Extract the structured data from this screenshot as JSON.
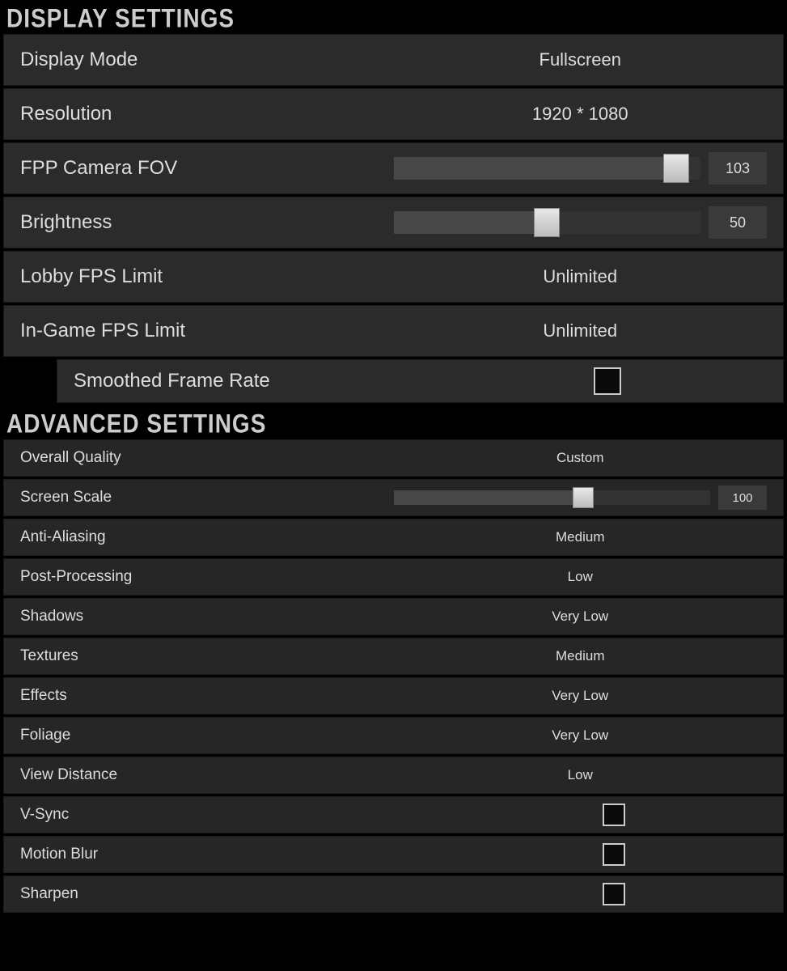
{
  "display": {
    "title": "DISPLAY SETTINGS",
    "mode": {
      "label": "Display Mode",
      "value": "Fullscreen"
    },
    "resolution": {
      "label": "Resolution",
      "value": "1920 * 1080"
    },
    "fov": {
      "label": "FPP Camera FOV",
      "value": "103",
      "percent": 92
    },
    "brightness": {
      "label": "Brightness",
      "value": "50",
      "percent": 50
    },
    "lobby_fps": {
      "label": "Lobby FPS Limit",
      "value": "Unlimited"
    },
    "ingame_fps": {
      "label": "In-Game FPS Limit",
      "value": "Unlimited"
    },
    "smoothed": {
      "label": "Smoothed Frame Rate",
      "checked": false
    }
  },
  "advanced": {
    "title": "ADVANCED SETTINGS",
    "overall": {
      "label": "Overall Quality",
      "value": "Custom"
    },
    "screen_scale": {
      "label": "Screen Scale",
      "value": "100",
      "percent": 60
    },
    "aa": {
      "label": "Anti-Aliasing",
      "value": "Medium"
    },
    "post": {
      "label": "Post-Processing",
      "value": "Low"
    },
    "shadows": {
      "label": "Shadows",
      "value": "Very Low"
    },
    "textures": {
      "label": "Textures",
      "value": "Medium"
    },
    "effects": {
      "label": "Effects",
      "value": "Very Low"
    },
    "foliage": {
      "label": "Foliage",
      "value": "Very Low"
    },
    "view_distance": {
      "label": "View Distance",
      "value": "Low"
    },
    "vsync": {
      "label": "V-Sync",
      "checked": false
    },
    "motion_blur": {
      "label": "Motion Blur",
      "checked": false
    },
    "sharpen": {
      "label": "Sharpen",
      "checked": false
    }
  }
}
